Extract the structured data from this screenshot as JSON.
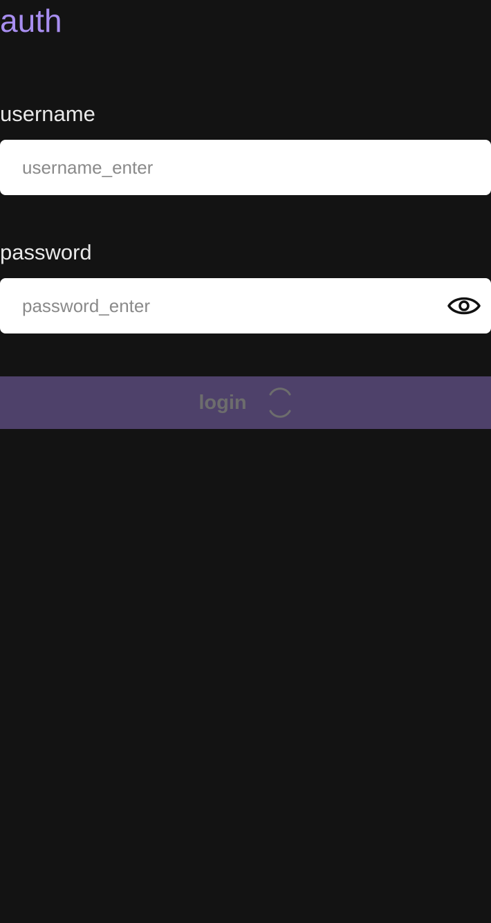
{
  "header": {
    "title": "auth"
  },
  "form": {
    "username": {
      "label": "username",
      "placeholder": "username_enter",
      "value": ""
    },
    "password": {
      "label": "password",
      "placeholder": "password_enter",
      "value": "",
      "toggle_icon": "eye-icon"
    },
    "submit": {
      "label": "login",
      "state": "loading",
      "indicator_icon": "spinner-icon"
    }
  },
  "colors": {
    "background": "#131313",
    "title": "#a88ef0",
    "label": "#e9e9e9",
    "input_background": "#ffffff",
    "button_background": "#4e416a",
    "button_text": "#6d6d6d"
  }
}
